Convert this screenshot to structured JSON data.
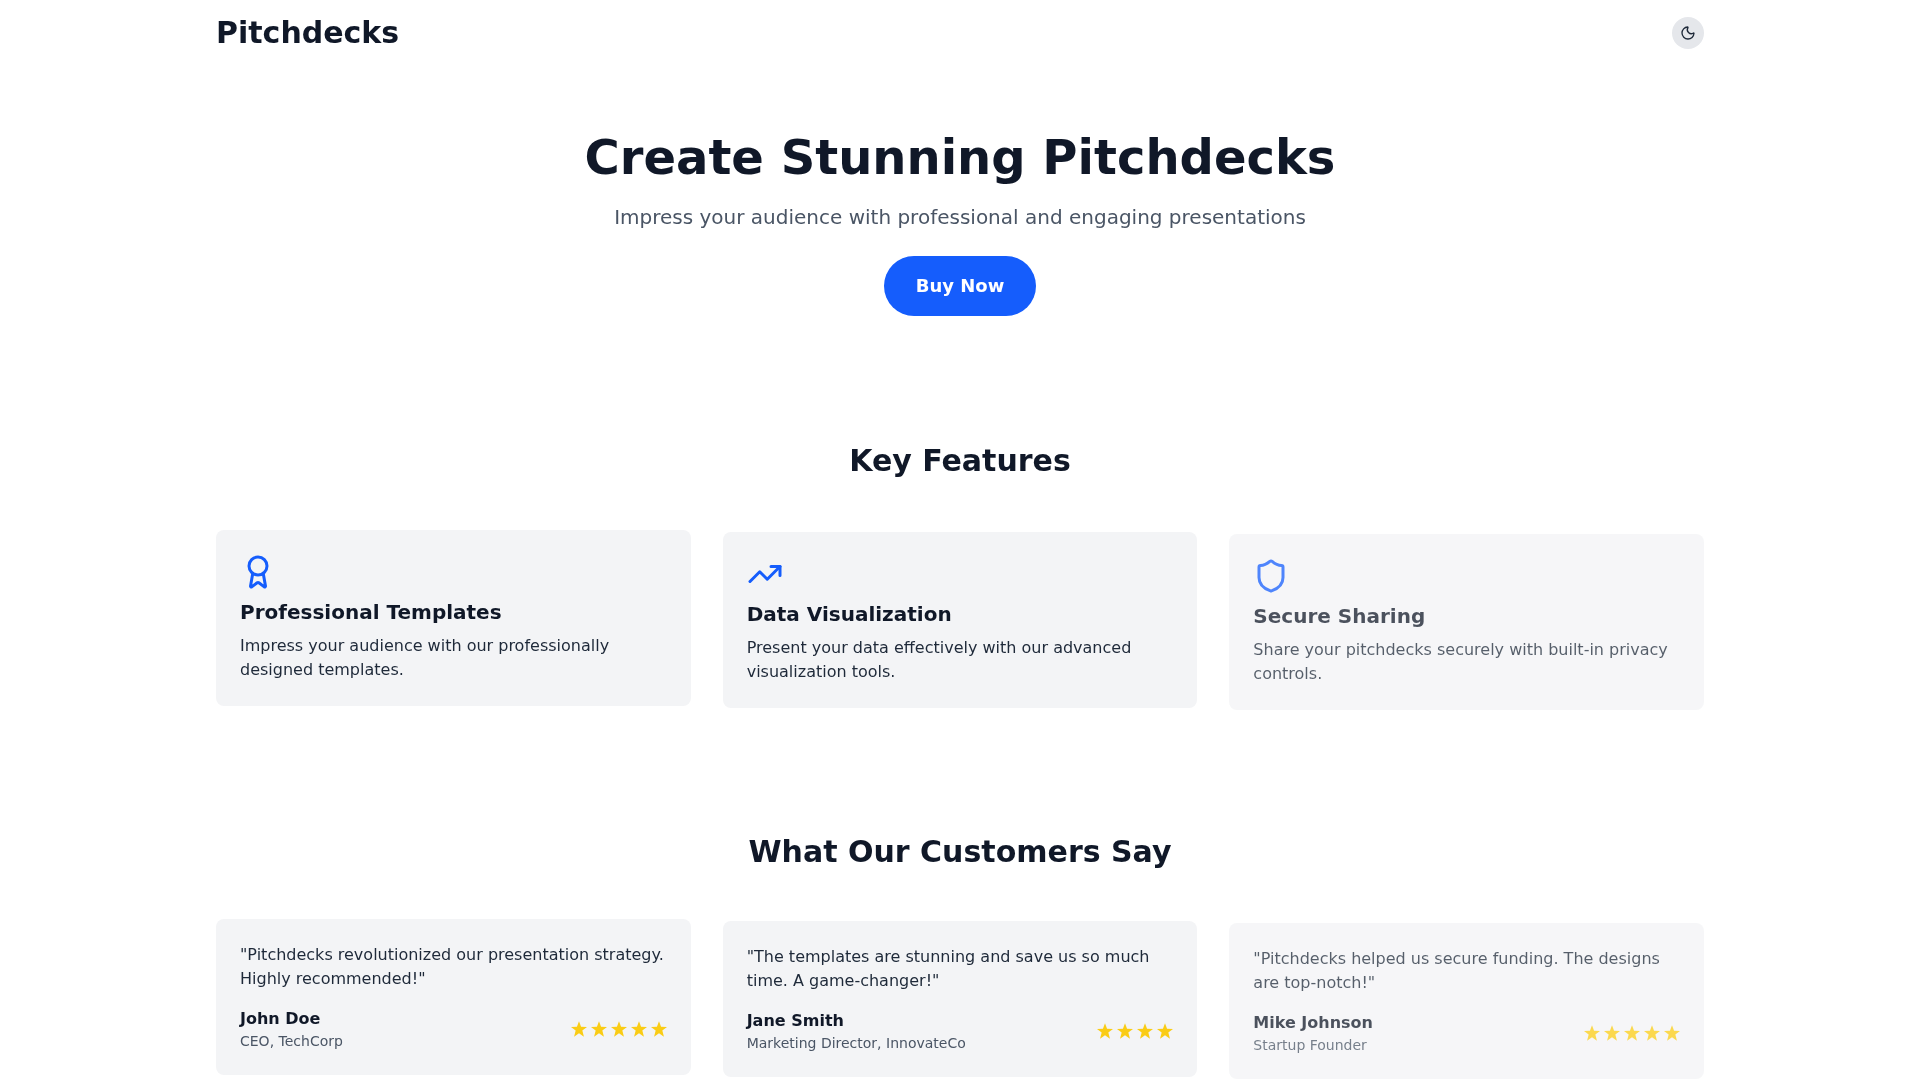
{
  "header": {
    "logo": "Pitchdecks"
  },
  "hero": {
    "title": "Create Stunning Pitchdecks",
    "subtitle": "Impress your audience with professional and engaging presentations",
    "cta": "Buy Now"
  },
  "features": {
    "heading": "Key Features",
    "items": [
      {
        "title": "Professional Templates",
        "description": "Impress your audience with our professionally designed templates."
      },
      {
        "title": "Data Visualization",
        "description": "Present your data effectively with our advanced visualization tools."
      },
      {
        "title": "Secure Sharing",
        "description": "Share your pitchdecks securely with built-in privacy controls."
      }
    ]
  },
  "testimonials": {
    "heading": "What Our Customers Say",
    "items": [
      {
        "quote": "\"Pitchdecks revolutionized our presentation strategy. Highly recommended!\"",
        "name": "John Doe",
        "role": "CEO, TechCorp",
        "stars": 5
      },
      {
        "quote": "\"The templates are stunning and save us so much time. A game-changer!\"",
        "name": "Jane Smith",
        "role": "Marketing Director, InnovateCo",
        "stars": 4
      },
      {
        "quote": "\"Pitchdecks helped us secure funding. The designs are top-notch!\"",
        "name": "Mike Johnson",
        "role": "Startup Founder",
        "stars": 5
      }
    ]
  }
}
